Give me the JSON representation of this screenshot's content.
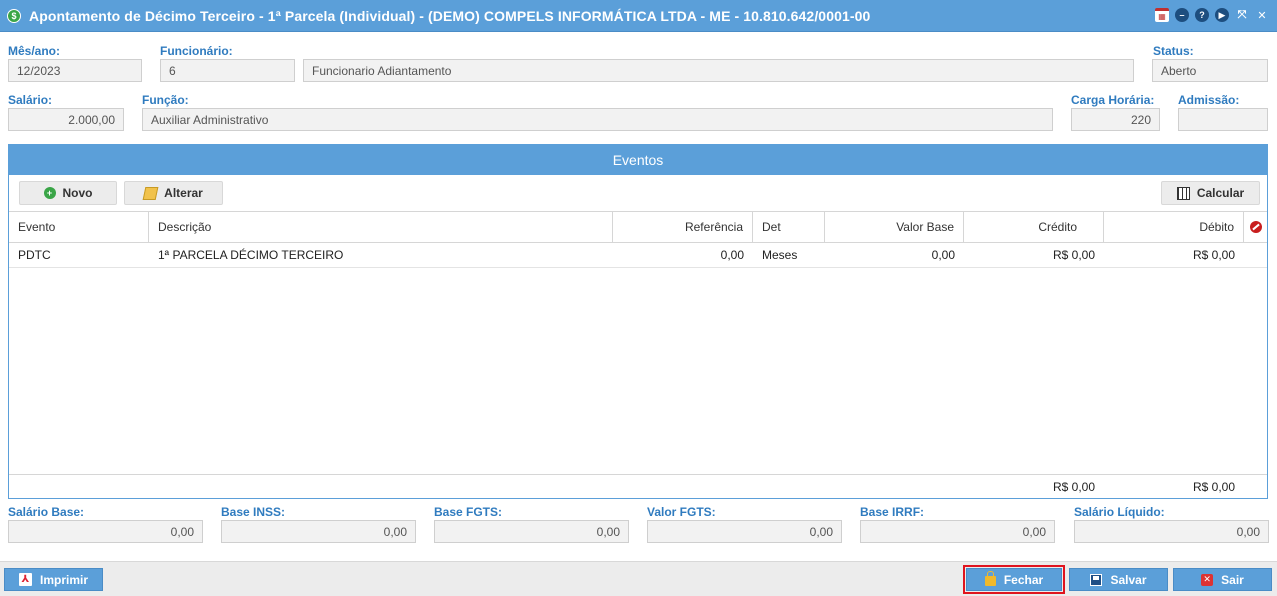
{
  "window": {
    "title": "Apontamento de Décimo Terceiro - 1ª Parcela (Individual) - (DEMO) COMPELS INFORMÁTICA LTDA - ME - 10.810.642/0001-00",
    "tools": [
      "calendar-icon",
      "minimize-icon",
      "help-icon",
      "play-icon",
      "fullscreen-icon",
      "close-icon"
    ]
  },
  "form": {
    "mes_ano_label": "Mês/ano:",
    "mes_ano_value": "12/2023",
    "funcionario_label": "Funcionário:",
    "funcionario_code": "6",
    "funcionario_name": "Funcionario Adiantamento",
    "status_label": "Status:",
    "status_value": "Aberto",
    "salario_label": "Salário:",
    "salario_value": "2.000,00",
    "funcao_label": "Função:",
    "funcao_value": "Auxiliar Administrativo",
    "carga_label": "Carga Horária:",
    "carga_value": "220",
    "admissao_label": "Admissão:",
    "admissao_value": ""
  },
  "eventos": {
    "title": "Eventos",
    "novo_label": "Novo",
    "alterar_label": "Alterar",
    "calcular_label": "Calcular",
    "columns": [
      "Evento",
      "Descrição",
      "Referência",
      "Det",
      "Valor Base",
      "Crédito",
      "Débito"
    ],
    "rows": [
      {
        "evento": "PDTC",
        "descricao": "1ª PARCELA DÉCIMO TERCEIRO",
        "referencia": "0,00",
        "det": "Meses",
        "valor_base": "0,00",
        "credito": "R$ 0,00",
        "debito": "R$ 0,00"
      }
    ],
    "total_credito": "R$ 0,00",
    "total_debito": "R$ 0,00"
  },
  "totals": [
    {
      "label": "Salário Base:",
      "value": "0,00"
    },
    {
      "label": "Base INSS:",
      "value": "0,00"
    },
    {
      "label": "Base FGTS:",
      "value": "0,00"
    },
    {
      "label": "Valor FGTS:",
      "value": "0,00"
    },
    {
      "label": "Base IRRF:",
      "value": "0,00"
    },
    {
      "label": "Salário Líquido:",
      "value": "0,00"
    }
  ],
  "actions": {
    "imprimir_label": "Imprimir",
    "fechar_label": "Fechar",
    "salvar_label": "Salvar",
    "sair_label": "Sair"
  },
  "colors": {
    "primary": "#5b9fd9",
    "label": "#2f7bbf",
    "highlight": "#e0141e"
  }
}
